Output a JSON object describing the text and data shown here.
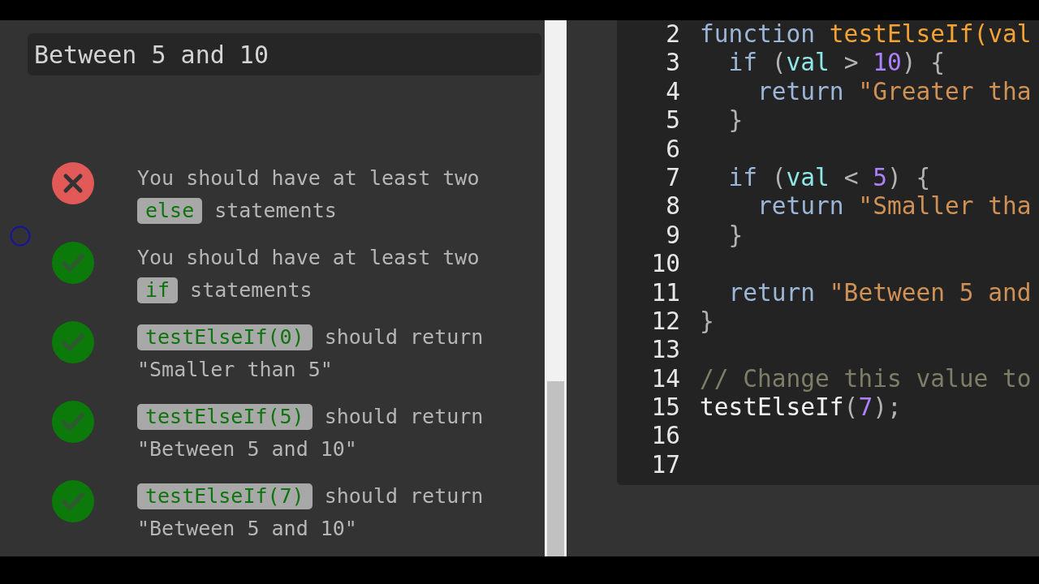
{
  "output": {
    "text": "Between 5 and 10"
  },
  "tests": [
    {
      "passed": false,
      "parts": [
        {
          "kind": "text",
          "text": "You should have at least two"
        },
        {
          "kind": "code",
          "text": "else"
        },
        {
          "kind": "text",
          "text": "statements"
        }
      ]
    },
    {
      "passed": true,
      "parts": [
        {
          "kind": "text",
          "text": "You should have at least two"
        },
        {
          "kind": "code",
          "text": "if"
        },
        {
          "kind": "text",
          "text": "statements"
        }
      ]
    },
    {
      "passed": true,
      "parts": [
        {
          "kind": "code",
          "text": "testElseIf(0)"
        },
        {
          "kind": "text",
          "text": "should return"
        },
        {
          "kind": "text",
          "text": "\"Smaller than 5\""
        }
      ]
    },
    {
      "passed": true,
      "parts": [
        {
          "kind": "code",
          "text": "testElseIf(5)"
        },
        {
          "kind": "text",
          "text": "should return"
        },
        {
          "kind": "text",
          "text": "\"Between 5 and 10\""
        }
      ]
    },
    {
      "passed": true,
      "parts": [
        {
          "kind": "code",
          "text": "testElseIf(7)"
        },
        {
          "kind": "text",
          "text": "should return"
        },
        {
          "kind": "text",
          "text": "\"Between 5 and 10\""
        }
      ]
    }
  ],
  "editor": {
    "lines": [
      {
        "number": "2",
        "tokens": [
          {
            "kind": "keyword",
            "text": "function"
          },
          {
            "kind": "def",
            "text": " testElseIf(val"
          }
        ],
        "children": [
          {
            "number": "3",
            "tokens": [
              {
                "kind": "keyword",
                "text": "if"
              },
              {
                "kind": "punct",
                "text": " ("
              },
              {
                "kind": "variable",
                "text": "val"
              },
              {
                "kind": "punct",
                "text": " > "
              },
              {
                "kind": "number",
                "text": "10"
              },
              {
                "kind": "punct",
                "text": ") {"
              }
            ],
            "children": [
              {
                "number": "4",
                "tokens": [
                  {
                    "kind": "keyword",
                    "text": "return"
                  },
                  {
                    "kind": "string",
                    "text": " \"Greater tha"
                  }
                ]
              }
            ]
          },
          {
            "number": "5",
            "tokens": [
              {
                "kind": "punct",
                "text": "}"
              }
            ]
          },
          {
            "number": "6"
          },
          {
            "number": "7",
            "tokens": [
              {
                "kind": "keyword",
                "text": "if"
              },
              {
                "kind": "punct",
                "text": " ("
              },
              {
                "kind": "variable",
                "text": "val"
              },
              {
                "kind": "punct",
                "text": " < "
              },
              {
                "kind": "number",
                "text": "5"
              },
              {
                "kind": "punct",
                "text": ") {"
              }
            ],
            "children": [
              {
                "number": "8",
                "tokens": [
                  {
                    "kind": "keyword",
                    "text": "return"
                  },
                  {
                    "kind": "string",
                    "text": " \"Smaller tha"
                  }
                ]
              }
            ]
          },
          {
            "number": "9",
            "tokens": [
              {
                "kind": "punct",
                "text": "}"
              }
            ]
          },
          {
            "number": "10"
          },
          {
            "number": "11",
            "tokens": [
              {
                "kind": "keyword",
                "text": "return"
              },
              {
                "kind": "string",
                "text": " \"Between 5 and"
              }
            ]
          }
        ]
      },
      {
        "number": "12",
        "tokens": [
          {
            "kind": "punct",
            "text": "}"
          }
        ]
      },
      {
        "number": "13"
      },
      {
        "number": "14",
        "tokens": [
          {
            "kind": "comment",
            "text": "// Change this value to"
          }
        ]
      },
      {
        "number": "15",
        "tokens": [
          {
            "kind": "plain",
            "text": "testElseIf"
          },
          {
            "kind": "punct",
            "text": "("
          },
          {
            "kind": "number",
            "text": "7"
          },
          {
            "kind": "punct",
            "text": ");"
          }
        ]
      },
      {
        "number": "16"
      },
      {
        "number": "17"
      }
    ]
  }
}
